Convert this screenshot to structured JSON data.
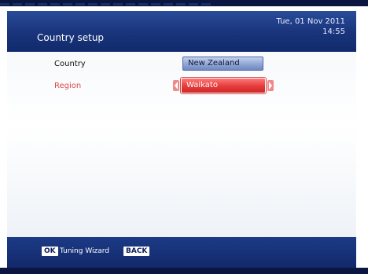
{
  "header": {
    "title": "Country setup",
    "date": "Tue, 01 Nov 2011",
    "time": "14:55"
  },
  "settings": {
    "country_label": "Country",
    "country_value": "New Zealand",
    "region_label": "Region",
    "region_value": "Waikato"
  },
  "footer": {
    "ok_key": "OK",
    "ok_action": "Tuning Wizard",
    "back_key": "BACK"
  },
  "colors": {
    "header_blue": "#1a357c",
    "highlight_red": "#e43a3a",
    "selected_label": "#e04848"
  },
  "icons": [
    "arrow-left-icon",
    "arrow-right-icon"
  ]
}
